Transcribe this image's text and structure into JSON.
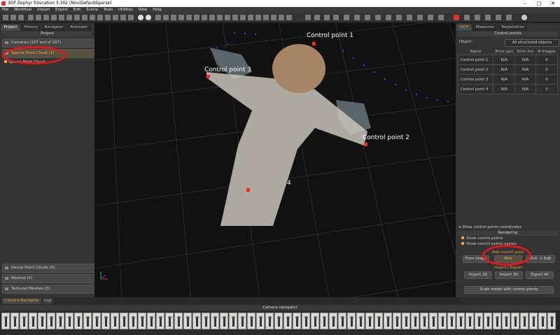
{
  "window": {
    "title": "3DF Zephyr Education 3.302 (NoviDefaultSparse)"
  },
  "menu": [
    "File",
    "Workflow",
    "Import",
    "Export",
    "Edit",
    "Scene",
    "Tools",
    "Utilities",
    "View",
    "Help"
  ],
  "left_panel": {
    "tabs": [
      "Project",
      "History",
      "Navigator",
      "Animator"
    ],
    "header": "Project",
    "items": {
      "cameras": "Cameras (197 out of 197)",
      "sparse": "Sparse Point Cloud (1)",
      "sparse_sub": "Sparse Point Cloud",
      "dense": "Dense Point Clouds (0)",
      "meshes": "Meshes (0)",
      "textured": "Textured Meshes (0)"
    }
  },
  "viewport": {
    "control_points": [
      {
        "label": "Control point 1"
      },
      {
        "label": "Control point 2"
      },
      {
        "label": "Control point 3"
      },
      {
        "label": "4"
      }
    ]
  },
  "right_panel": {
    "tabs": [
      "GCP",
      "Measures",
      "Registration"
    ],
    "header": "Control points",
    "object_label": "Object:",
    "object_value": "All structured objects",
    "columns": [
      "Name",
      "Error (px)",
      "Error (m)",
      "# Images"
    ],
    "rows": [
      {
        "name": "Control point 1",
        "err_px": "N/A",
        "err_m": "N/A",
        "images": "0"
      },
      {
        "name": "Control point 2",
        "err_px": "N/A",
        "err_m": "N/A",
        "images": "0"
      },
      {
        "name": "Control point 3",
        "err_px": "N/A",
        "err_m": "N/A",
        "images": "0"
      },
      {
        "name": "Control point 4",
        "err_px": "N/A",
        "err_m": "N/A",
        "images": "0"
      }
    ],
    "show_coords": "Show control points coordinates",
    "rendering_header": "Rendering",
    "show_cp": "Show control points",
    "show_cp_names": "Show control points names",
    "add_header": "Add control point",
    "from_image": "From image",
    "pick": "Pick",
    "edit": "Pick -> Edit",
    "io_header": "Import / Export",
    "import2d": "Import 2D",
    "import3d": "Import 3D",
    "exportall": "Export All",
    "scale_btn": "Scale model with control points"
  },
  "bottom": {
    "tabs": [
      "Camera Navigator",
      "Log"
    ],
    "nav_header": "Camera navigator"
  },
  "colors": {
    "accent": "#f0a030",
    "annotation": "#e8141c",
    "cp_marker": "#ff2020"
  }
}
